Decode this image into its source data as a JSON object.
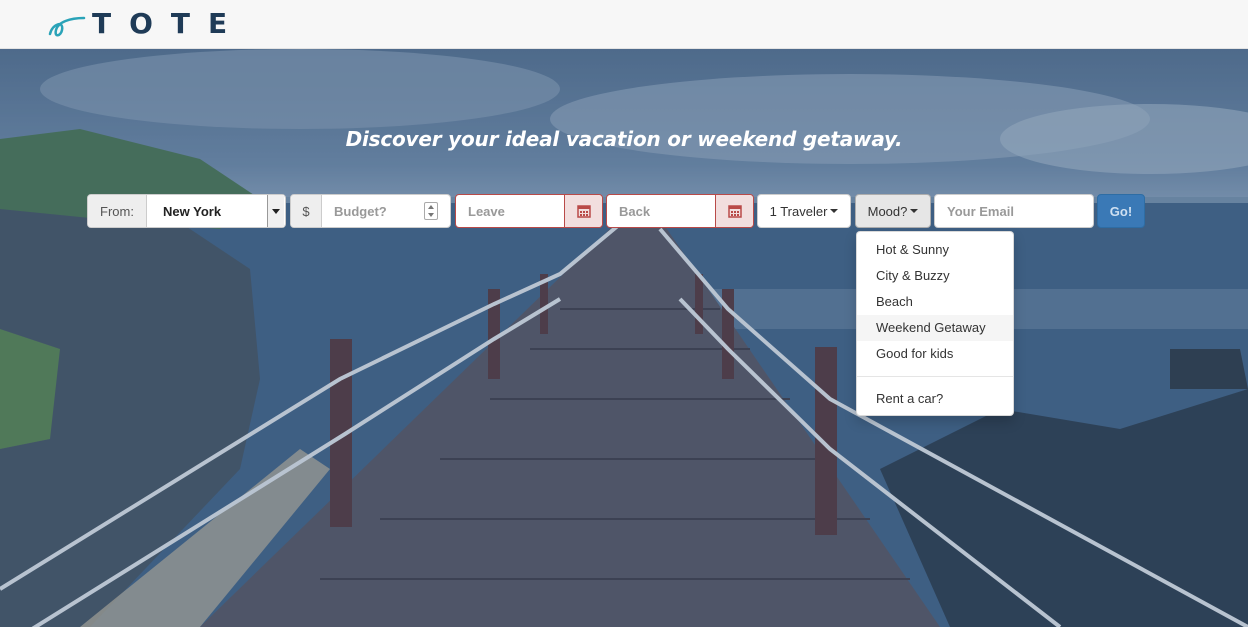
{
  "header": {
    "logo_text": "TOTE",
    "logo_icon": "swoosh-icon"
  },
  "hero": {
    "headline": "Discover your ideal vacation or weekend getaway."
  },
  "search": {
    "from_label": "From:",
    "from_value": "New York",
    "budget_addon": "$",
    "budget_placeholder": "Budget?",
    "leave_placeholder": "Leave",
    "back_placeholder": "Back",
    "traveler_label": "1 Traveler",
    "mood_label": "Mood?",
    "email_placeholder": "Your Email",
    "go_label": "Go!"
  },
  "mood_menu": {
    "items": [
      "Hot & Sunny",
      "City & Buzzy",
      "Beach",
      "Weekend Getaway",
      "Good for kids"
    ],
    "extra": "Rent a car?"
  },
  "colors": {
    "brand_navy": "#1f3b57",
    "brand_teal": "#2aa3b8",
    "go_blue": "#3a79b6",
    "error_red": "#b94a48"
  }
}
